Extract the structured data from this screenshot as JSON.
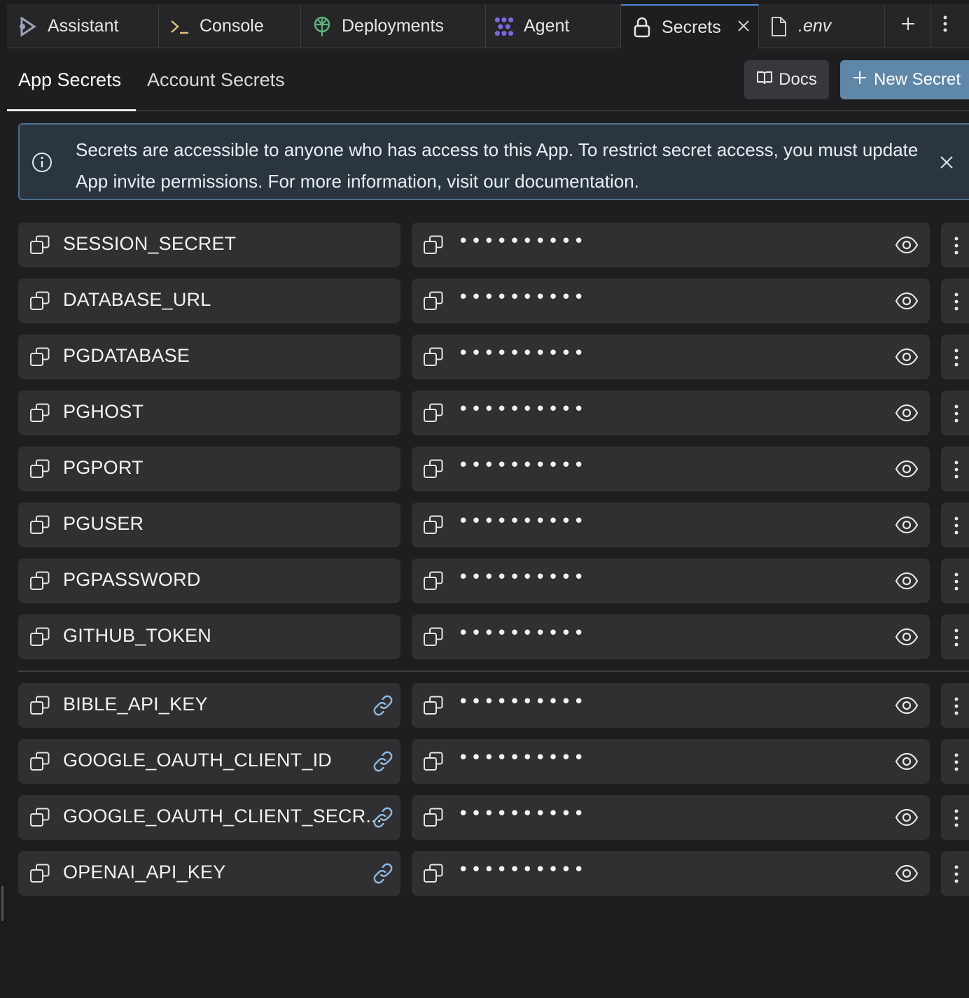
{
  "tabs": [
    {
      "label": "Assistant",
      "icon": "assistant-icon"
    },
    {
      "label": "Console",
      "icon": "terminal-icon"
    },
    {
      "label": "Deployments",
      "icon": "deployments-icon"
    },
    {
      "label": "Agent",
      "icon": "agent-icon"
    },
    {
      "label": "Secrets",
      "icon": "lock-icon",
      "active": true
    },
    {
      "label": ".env",
      "icon": "file-icon"
    }
  ],
  "subtabs": {
    "app": "App Secrets",
    "account": "Account Secrets"
  },
  "buttons": {
    "docs": "Docs",
    "new_secret": "New Secret"
  },
  "banner": {
    "text": "Secrets are accessible to anyone who has access to this App. To restrict secret access, you must update App invite permissions. For more information, visit our documentation."
  },
  "masked_value": "••••••••••",
  "secrets": [
    {
      "key": "SESSION_SECRET"
    },
    {
      "key": "DATABASE_URL"
    },
    {
      "key": "PGDATABASE"
    },
    {
      "key": "PGHOST"
    },
    {
      "key": "PGPORT"
    },
    {
      "key": "PGUSER"
    },
    {
      "key": "PGPASSWORD"
    },
    {
      "key": "GITHUB_TOKEN"
    }
  ],
  "linked_secrets": [
    {
      "key": "BIBLE_API_KEY"
    },
    {
      "key": "GOOGLE_OAUTH_CLIENT_ID"
    },
    {
      "key": "GOOGLE_OAUTH_CLIENT_SECR..."
    },
    {
      "key": "OPENAI_API_KEY"
    }
  ],
  "colors": {
    "accent": "#5f87a8",
    "banner_bg": "#2a3540",
    "row_bg": "#303033",
    "link_icon": "#8fb6de"
  }
}
